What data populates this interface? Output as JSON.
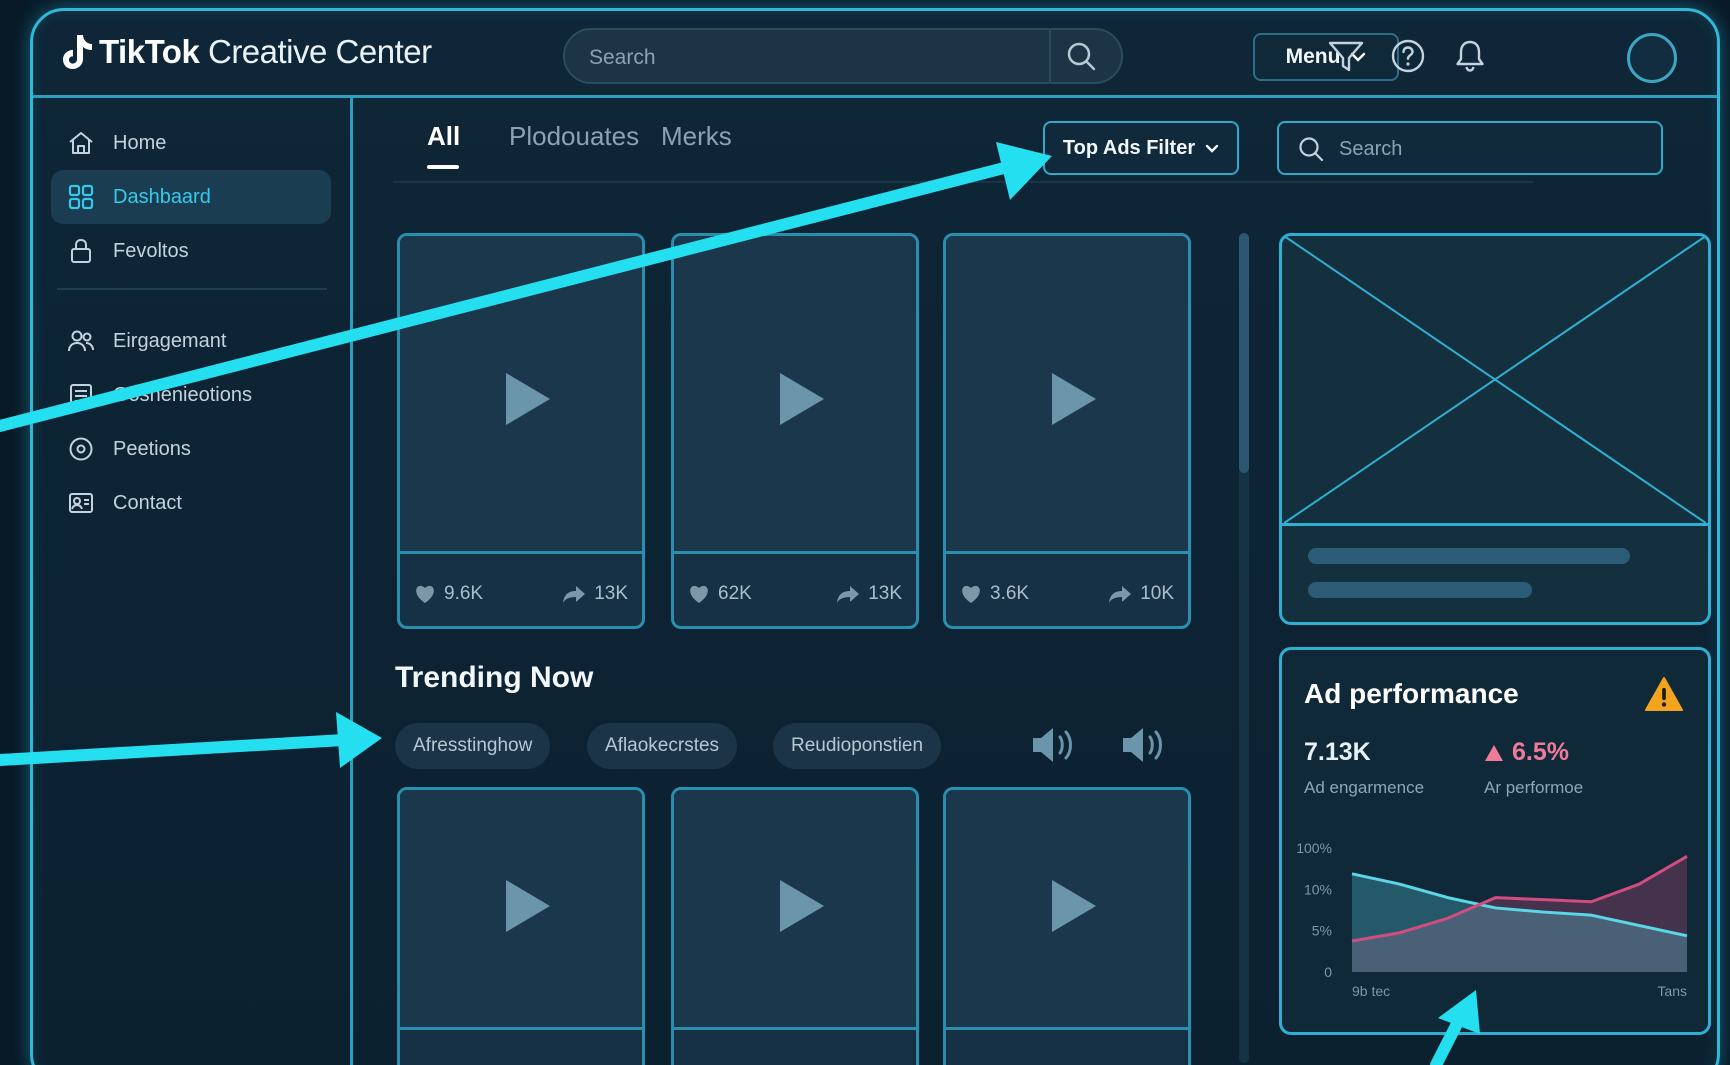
{
  "app": {
    "brand_bold": "TikTok",
    "brand_rest": " Creative Center"
  },
  "topbar": {
    "search_placeholder": "Search",
    "menu_label": "Menu"
  },
  "sidebar": {
    "items": [
      {
        "label": "Home",
        "icon": "home-icon"
      },
      {
        "label": "Dashbaard",
        "icon": "grid-icon",
        "active": true
      },
      {
        "label": "Fevoltos",
        "icon": "lock-icon"
      },
      {
        "label": "Eirgagemant",
        "icon": "users-icon"
      },
      {
        "label": "Gosnenieotions",
        "icon": "list-icon"
      },
      {
        "label": "Peetions",
        "icon": "circle-icon"
      },
      {
        "label": "Contact",
        "icon": "contact-icon"
      }
    ]
  },
  "main": {
    "tabs": [
      {
        "label": "All",
        "active": true
      },
      {
        "label": "Plodouates"
      },
      {
        "label": "Merks"
      }
    ],
    "filter_label": "Top Ads Filter",
    "search_placeholder": "Search",
    "videos": [
      {
        "likes": "9.6K",
        "shares": "13K"
      },
      {
        "likes": "62K",
        "shares": "13K"
      },
      {
        "likes": "3.6K",
        "shares": "10K"
      }
    ],
    "trending_title": "Trending Now",
    "chips": [
      "Afresstinghow",
      "Aflaokecrstes",
      "Reudioponstien"
    ]
  },
  "ad_performance": {
    "title": "Ad performance",
    "engagement_value": "7.13K",
    "engagement_label": "Ad engarmence",
    "performance_value": "6.5%",
    "performance_label": "Ar performoe"
  },
  "chart_data": {
    "type": "area",
    "yticks": [
      "100%",
      "10%",
      "5%",
      "0"
    ],
    "xticks": [
      "9b tec",
      "Tans"
    ],
    "series": [
      {
        "color": "#5ad6e6",
        "values": [
          95,
          85,
          72,
          62,
          58,
          55,
          45,
          35
        ]
      },
      {
        "color": "#d24d7f",
        "values": [
          30,
          38,
          52,
          72,
          70,
          68,
          85,
          112
        ]
      }
    ],
    "ylim": [
      0,
      120
    ]
  },
  "colors": {
    "accent": "#2fb8d8",
    "arrow": "#24dff0",
    "warning": "#f2a41e",
    "negative": "#f07a9a"
  }
}
